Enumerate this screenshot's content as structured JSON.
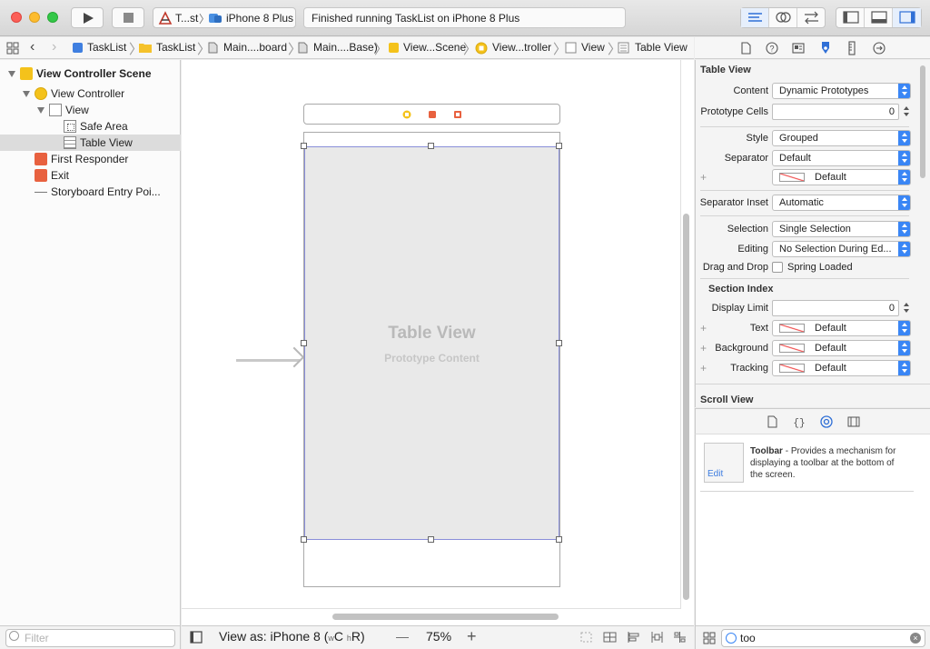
{
  "toolbar": {
    "scheme_app": "T...st",
    "scheme_device": "iPhone 8 Plus",
    "status": "Finished running TaskList on iPhone 8 Plus"
  },
  "jumpbar": {
    "items": [
      "TaskList",
      "TaskList",
      "Main....board",
      "Main....Base)",
      "View...Scene",
      "View...troller",
      "View",
      "Table View"
    ]
  },
  "navigator": {
    "scene": "View Controller Scene",
    "view_controller": "View Controller",
    "view": "View",
    "safe_area": "Safe Area",
    "table_view": "Table View",
    "first_responder": "First Responder",
    "exit": "Exit",
    "entry": "Storyboard Entry Poi...",
    "filter_placeholder": "Filter"
  },
  "canvas": {
    "tv_title": "Table View",
    "tv_subtitle": "Prototype Content",
    "view_as": "View as: iPhone 8 (",
    "size_w": "w",
    "size_c": "C",
    "size_h": "h",
    "size_r": "R)",
    "zoom": "75%",
    "minus": "—",
    "plus": "+"
  },
  "inspector": {
    "table_view_head": "Table View",
    "content_label": "Content",
    "content_value": "Dynamic Prototypes",
    "prototype_cells_label": "Prototype Cells",
    "prototype_cells_value": "0",
    "style_label": "Style",
    "style_value": "Grouped",
    "separator_label": "Separator",
    "separator_value": "Default",
    "separator_color_value": "Default",
    "separator_inset_label": "Separator Inset",
    "separator_inset_value": "Automatic",
    "selection_label": "Selection",
    "selection_value": "Single Selection",
    "editing_label": "Editing",
    "editing_value": "No Selection During Ed...",
    "drag_drop_label": "Drag and Drop",
    "drag_drop_value": "Spring Loaded",
    "section_index_head": "Section Index",
    "display_limit_label": "Display Limit",
    "display_limit_value": "0",
    "text_label": "Text",
    "text_value": "Default",
    "background_label": "Background",
    "background_value": "Default",
    "tracking_label": "Tracking",
    "tracking_value": "Default",
    "scroll_view_head": "Scroll View",
    "plus": "+"
  },
  "library": {
    "item_name": "Toolbar",
    "item_desc": " - Provides a mechanism for displaying a toolbar at the bottom of the screen.",
    "edit": "Edit",
    "filter_value": "too",
    "clear": "×"
  },
  "colors": {
    "accent": "#3a86f5",
    "selection_outline": "#8a8fd9",
    "scene_icon": "#f4c21b",
    "responder_icon": "#e8613f"
  }
}
